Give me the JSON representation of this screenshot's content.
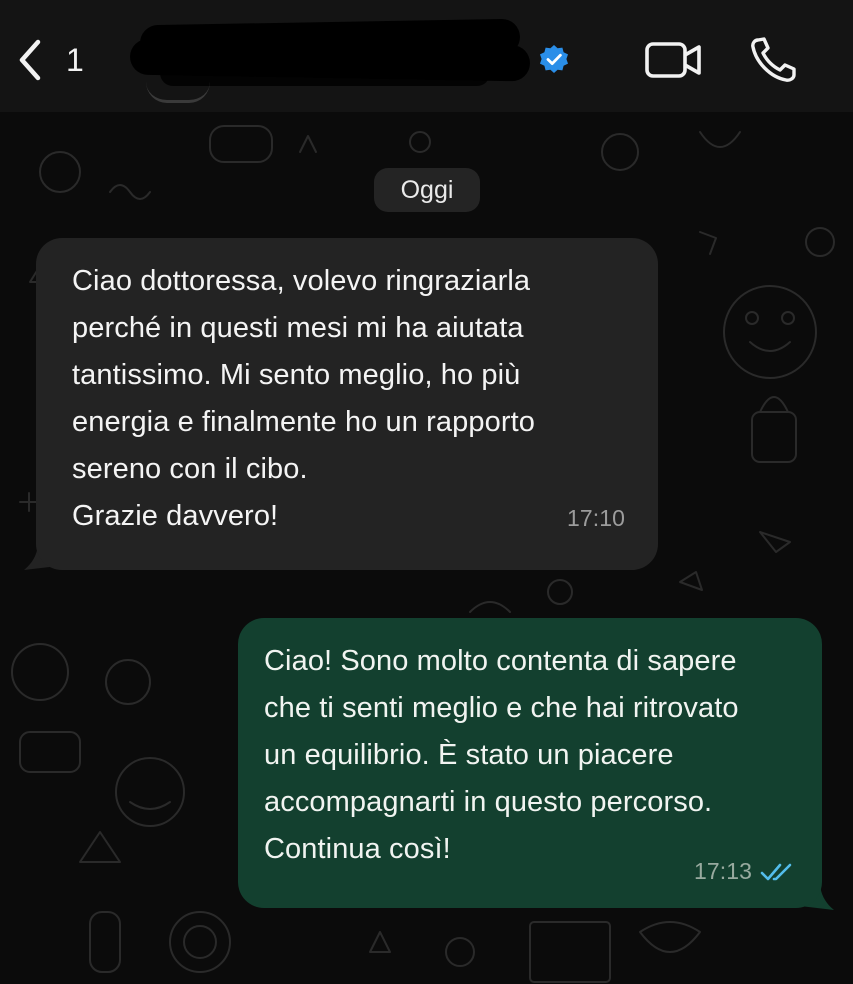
{
  "header": {
    "unread_count": "1",
    "contact_name": "",
    "icons": {
      "back": "chevron-left-icon",
      "verified": "verified-badge-icon",
      "video": "video-camera-icon",
      "call": "phone-icon"
    }
  },
  "chat": {
    "date_separator": "Oggi",
    "messages": [
      {
        "direction": "incoming",
        "lines": [
          "Ciao dottoressa, volevo ringraziarla",
          "perché in questi mesi mi ha aiutata",
          "tantissimo. Mi sento meglio, ho più",
          "energia e finalmente ho un rapporto",
          "sereno con il cibo.",
          "Grazie davvero!"
        ],
        "time": "17:10"
      },
      {
        "direction": "outgoing",
        "lines": [
          "Ciao! Sono molto contenta di sapere",
          "che ti senti meglio e che hai ritrovato",
          "un equilibrio. È stato un piacere",
          "accompagnarti in questo percorso.",
          "Continua così!"
        ],
        "time": "17:13",
        "status_icon": "double-check-read-icon"
      }
    ]
  },
  "colors": {
    "header_bg": "#141414",
    "chat_bg": "#0b0b0b",
    "incoming_bubble": "#232323",
    "outgoing_bubble": "#13402f",
    "verified_blue": "#2a8ee8",
    "read_tick_blue": "#53bdeb"
  }
}
